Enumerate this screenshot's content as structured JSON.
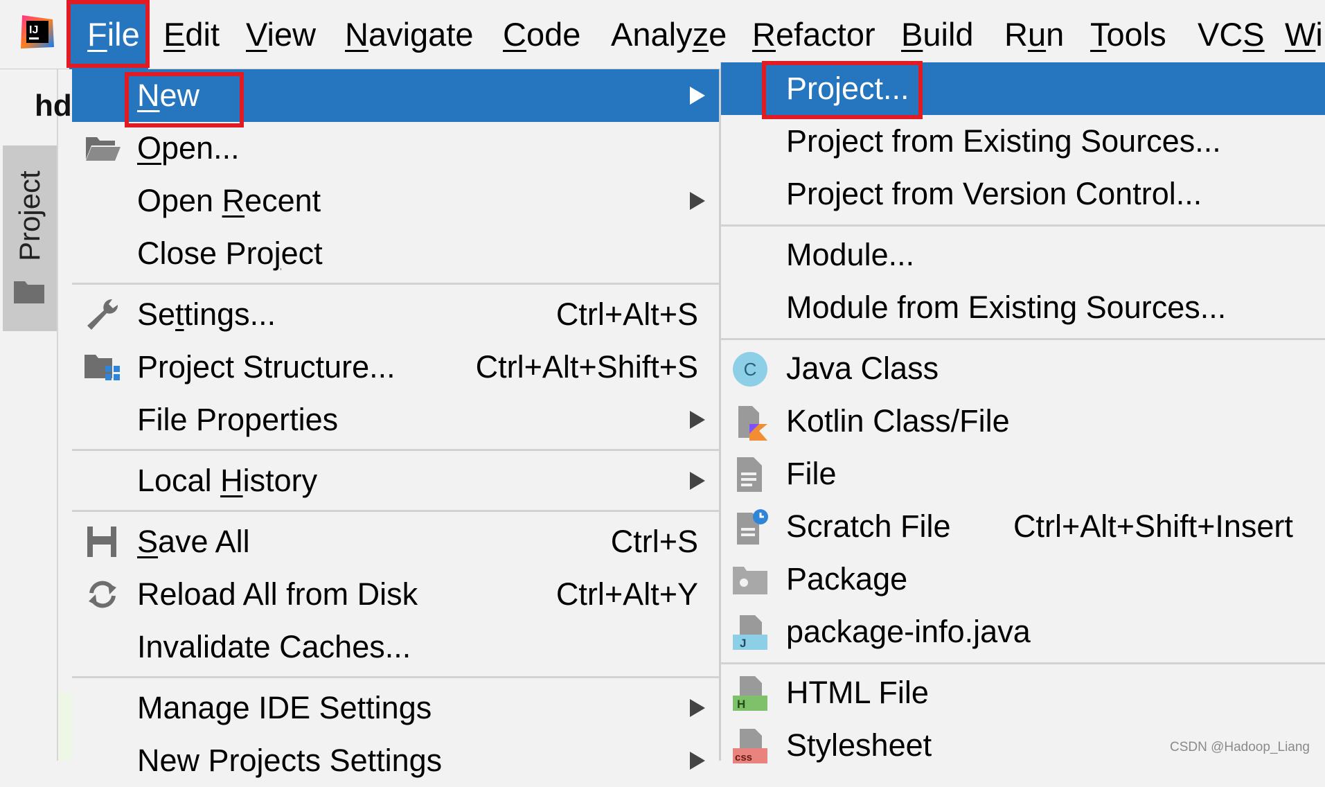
{
  "menubar": {
    "items": [
      {
        "pre": "",
        "key": "F",
        "post": "ile"
      },
      {
        "pre": "",
        "key": "E",
        "post": "dit"
      },
      {
        "pre": "",
        "key": "V",
        "post": "iew"
      },
      {
        "pre": "",
        "key": "N",
        "post": "avigate"
      },
      {
        "pre": "",
        "key": "C",
        "post": "ode"
      },
      {
        "pre": "Analy",
        "key": "z",
        "post": "e"
      },
      {
        "pre": "",
        "key": "R",
        "post": "efactor"
      },
      {
        "pre": "",
        "key": "B",
        "post": "uild"
      },
      {
        "pre": "R",
        "key": "u",
        "post": "n"
      },
      {
        "pre": "",
        "key": "T",
        "post": "ools"
      },
      {
        "pre": "VC",
        "key": "S",
        "post": ""
      },
      {
        "pre": "",
        "key": "W",
        "post": "i"
      }
    ]
  },
  "sidebar": {
    "project_tab": "Project",
    "editor_title": "hd"
  },
  "file_menu": {
    "items": [
      {
        "pre": "",
        "key": "N",
        "post": "ew",
        "shortcut": ""
      },
      {
        "pre": "",
        "key": "O",
        "post": "pen...",
        "shortcut": ""
      },
      {
        "pre": "Open ",
        "key": "R",
        "post": "ecent",
        "shortcut": ""
      },
      {
        "pre": "Close Pro",
        "key": "j",
        "post": "ect",
        "shortcut": ""
      },
      {
        "pre": "Se",
        "key": "t",
        "post": "tings...",
        "shortcut": "Ctrl+Alt+S"
      },
      {
        "pre": "Project Structure...",
        "key": "",
        "post": "",
        "shortcut": "Ctrl+Alt+Shift+S"
      },
      {
        "pre": "File Properties",
        "key": "",
        "post": "",
        "shortcut": ""
      },
      {
        "pre": "Local ",
        "key": "H",
        "post": "istory",
        "shortcut": ""
      },
      {
        "pre": "",
        "key": "S",
        "post": "ave All",
        "shortcut": "Ctrl+S"
      },
      {
        "pre": "Reload All from Disk",
        "key": "",
        "post": "",
        "shortcut": "Ctrl+Alt+Y"
      },
      {
        "pre": "Invalidate Caches...",
        "key": "",
        "post": "",
        "shortcut": ""
      },
      {
        "pre": "Manage IDE Settings",
        "key": "",
        "post": "",
        "shortcut": ""
      },
      {
        "pre": "New Projects Settings",
        "key": "",
        "post": "",
        "shortcut": ""
      }
    ]
  },
  "new_menu": {
    "items": [
      {
        "label": "Project...",
        "shortcut": ""
      },
      {
        "label": "Project from Existing Sources...",
        "shortcut": ""
      },
      {
        "label": "Project from Version Control...",
        "shortcut": ""
      },
      {
        "label": "Module...",
        "shortcut": ""
      },
      {
        "label": "Module from Existing Sources...",
        "shortcut": ""
      },
      {
        "label": "Java Class",
        "shortcut": ""
      },
      {
        "label": "Kotlin Class/File",
        "shortcut": ""
      },
      {
        "label": "File",
        "shortcut": ""
      },
      {
        "label": "Scratch File",
        "shortcut": "Ctrl+Alt+Shift+Insert"
      },
      {
        "label": "Package",
        "shortcut": ""
      },
      {
        "label": "package-info.java",
        "shortcut": ""
      },
      {
        "label": "HTML File",
        "shortcut": ""
      },
      {
        "label": "Stylesheet",
        "shortcut": ""
      }
    ]
  },
  "icons": {
    "app_logo_text": "IJ",
    "java_class_glyph": "C",
    "package_info_glyph": "J",
    "html_glyph": "H",
    "css_glyph": "css"
  },
  "watermark": "CSDN @Hadoop_Liang",
  "colors": {
    "selection": "#2675bf",
    "highlight_box": "#e01b24",
    "background": "#f2f2f2"
  }
}
